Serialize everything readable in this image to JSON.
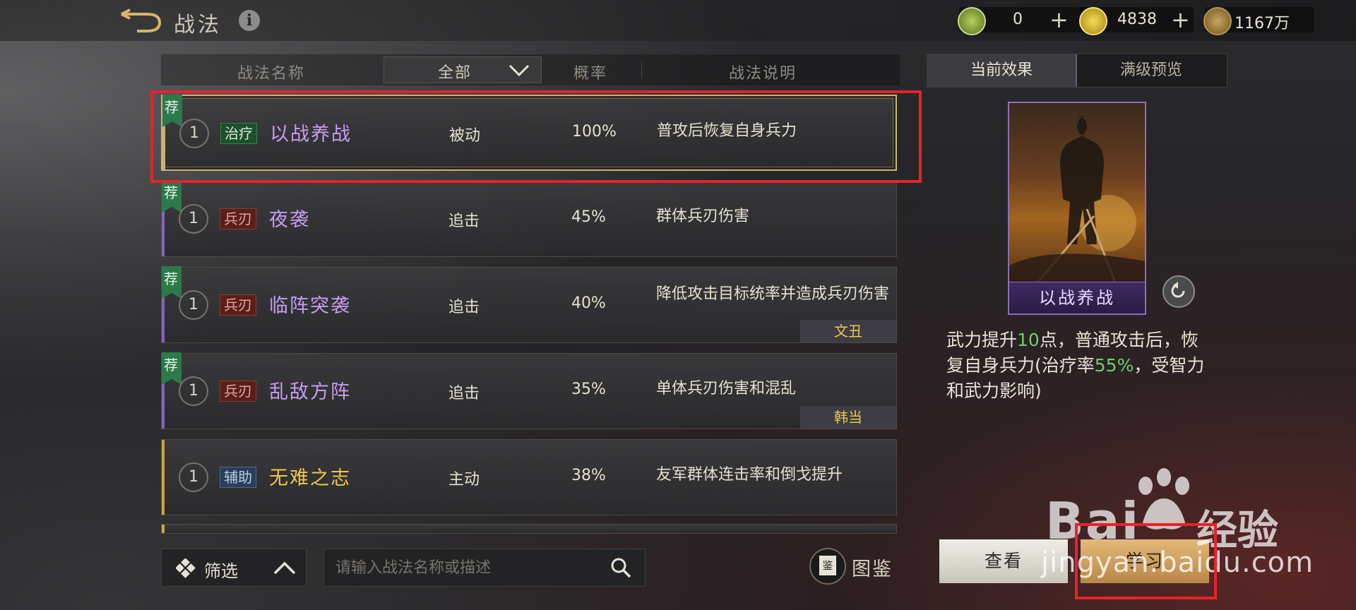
{
  "header": {
    "title": "战法",
    "info_icon": "i",
    "currencies": [
      {
        "icon": "jade-coin-icon",
        "value": "0",
        "color": "#7ea33a"
      },
      {
        "icon": "gold-coin-icon",
        "value": "4838",
        "color": "#d6b21c"
      },
      {
        "icon": "copper-coin-icon",
        "value": "1167万",
        "color": "#9a7a3a"
      }
    ],
    "plus": "+"
  },
  "table": {
    "columns": {
      "name": "战法名称",
      "filter": "全部",
      "rate": "概率",
      "desc": "战法说明"
    },
    "rows": [
      {
        "recommended": "荐",
        "level": "1",
        "tag": "治疗",
        "tag_type": "heal",
        "name": "以战养战",
        "name_color": "#c69cf0",
        "type": "被动",
        "rate": "100%",
        "desc": "普攻后恢复自身兵力",
        "owner": "",
        "bar": "#c8b27a"
      },
      {
        "recommended": "荐",
        "level": "1",
        "tag": "兵刃",
        "tag_type": "blade",
        "name": "夜袭",
        "name_color": "#c69cf0",
        "type": "追击",
        "rate": "45%",
        "desc": "群体兵刃伤害",
        "owner": "",
        "bar": "#8a62b8"
      },
      {
        "recommended": "荐",
        "level": "1",
        "tag": "兵刃",
        "tag_type": "blade",
        "name": "临阵突袭",
        "name_color": "#c69cf0",
        "type": "追击",
        "rate": "40%",
        "desc": "降低攻击目标统率并造成兵刃伤害",
        "owner": "文丑",
        "bar": "#8a62b8"
      },
      {
        "recommended": "荐",
        "level": "1",
        "tag": "兵刃",
        "tag_type": "blade",
        "name": "乱敌方阵",
        "name_color": "#c69cf0",
        "type": "追击",
        "rate": "35%",
        "desc": "单体兵刃伤害和混乱",
        "owner": "韩当",
        "bar": "#8a62b8"
      },
      {
        "recommended": "",
        "level": "1",
        "tag": "辅助",
        "tag_type": "aux",
        "name": "无难之志",
        "name_color": "#f0c64a",
        "type": "主动",
        "rate": "38%",
        "desc": "友军群体连击率和倒戈提升",
        "owner": "",
        "bar": "#c8a24a"
      }
    ]
  },
  "bottom": {
    "filter_label": "筛选",
    "search_placeholder": "请输入战法名称或描述",
    "atlas_icon_char": "鉴",
    "atlas_label": "图鉴"
  },
  "panel": {
    "tabs": [
      "当前效果",
      "满级预览"
    ],
    "card_name": "以战养战",
    "effect_parts": [
      "武力提升",
      "10",
      "点，普通攻击后，恢复自身兵力(治疗率",
      "55%",
      "，受智力和武力影响)"
    ],
    "view_label": "查看",
    "learn_label": "学习"
  },
  "watermark": {
    "brand": "Bai",
    "brand2": "经验",
    "url": "jingyan.baidu.com"
  }
}
